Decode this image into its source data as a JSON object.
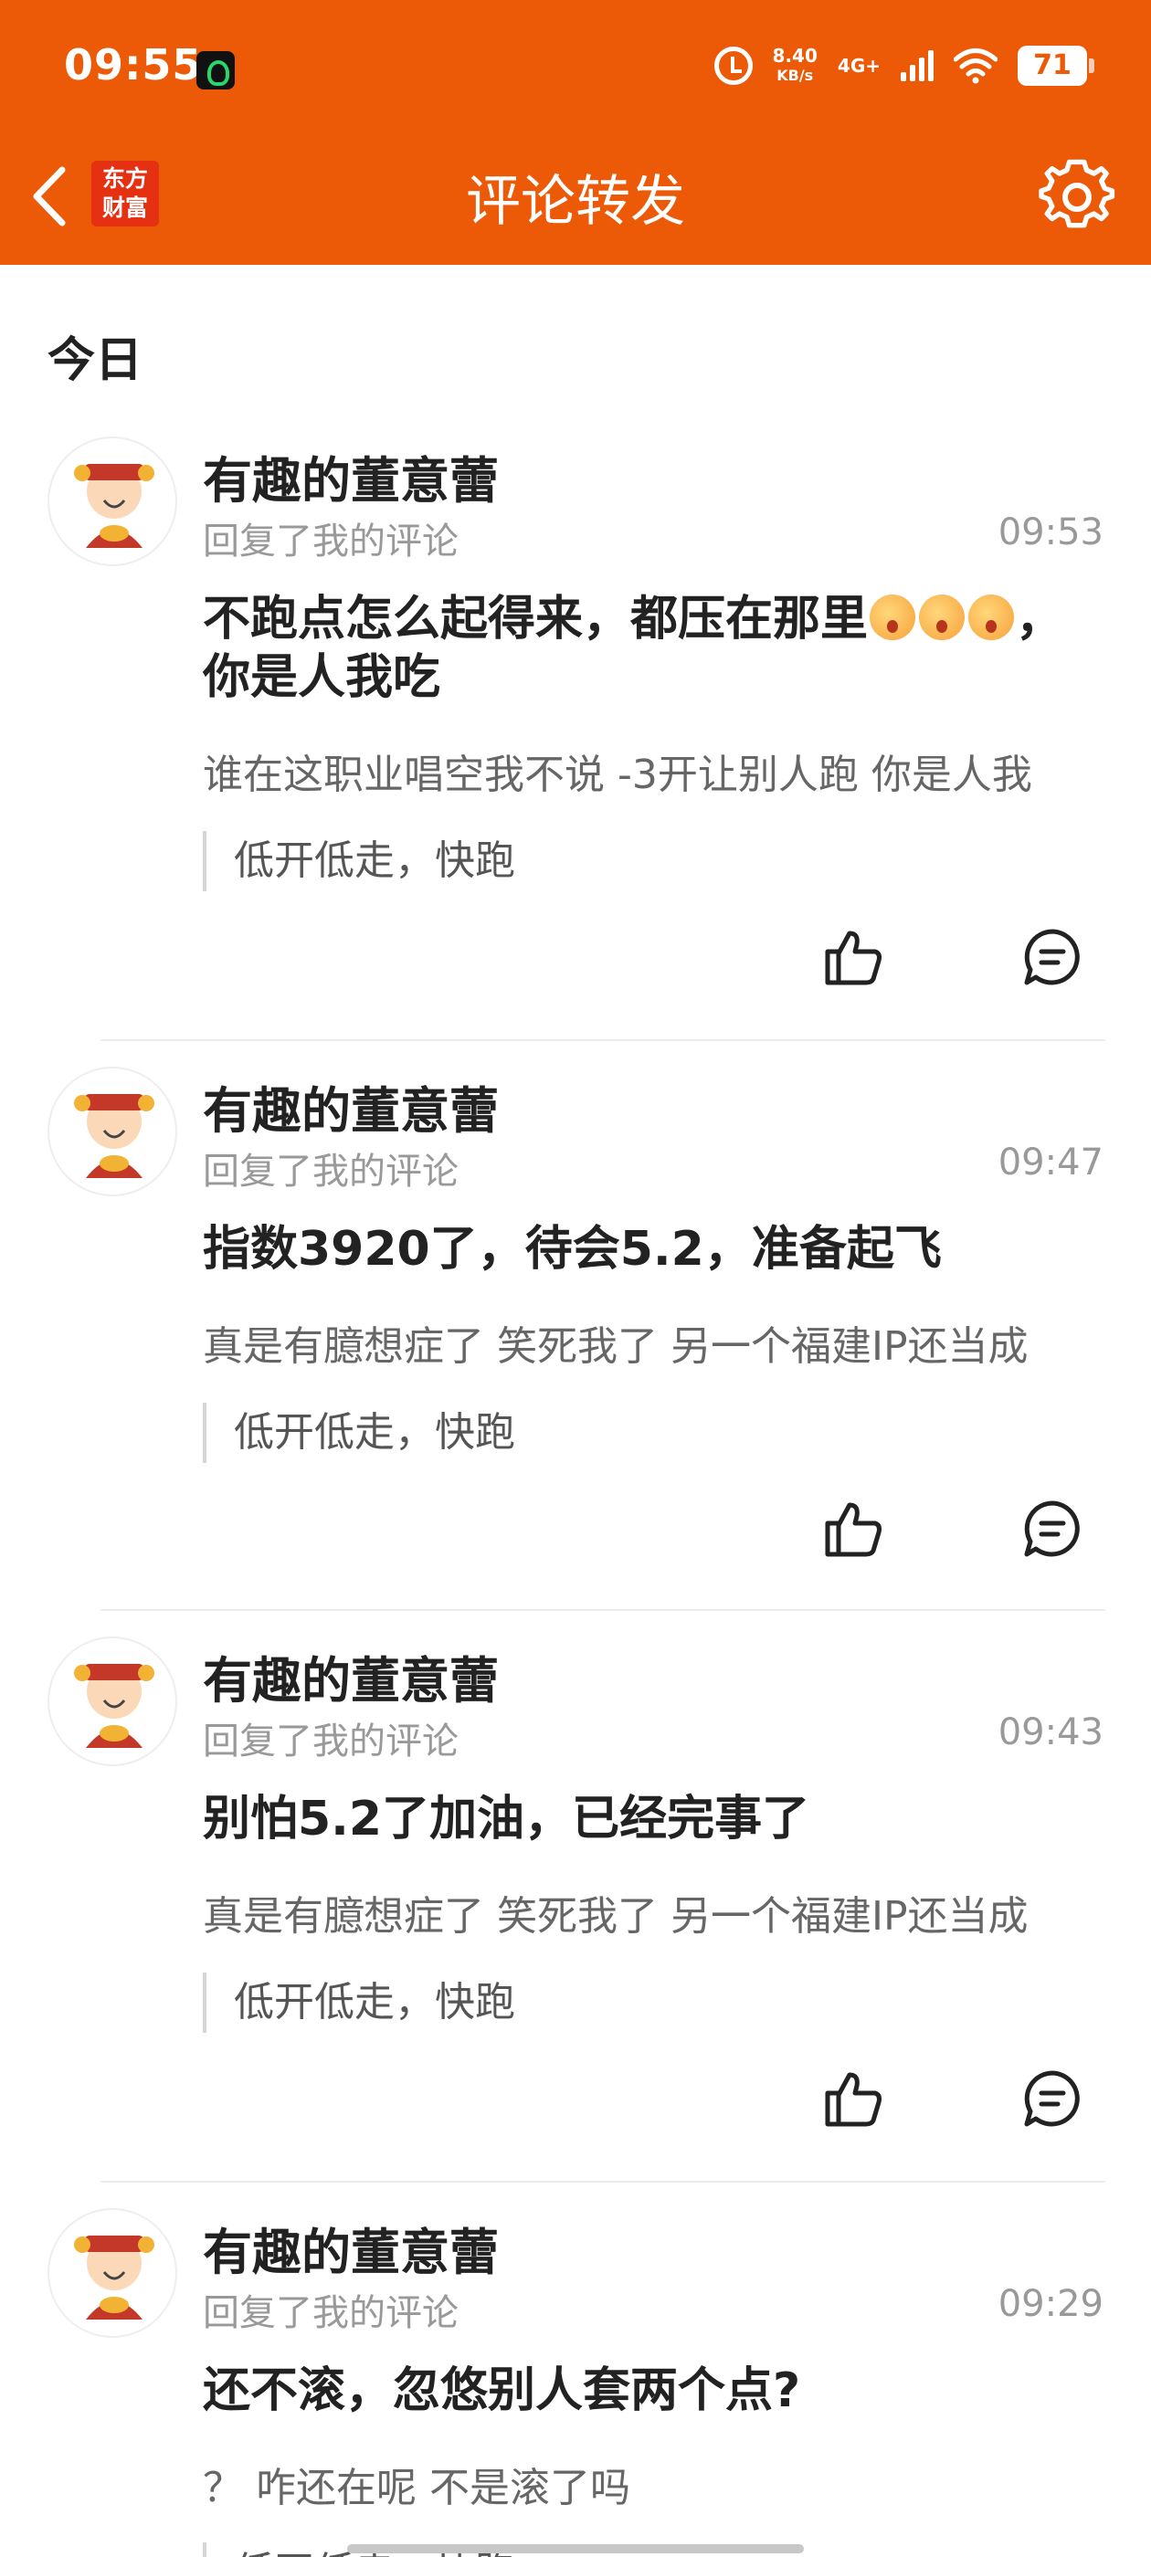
{
  "status_bar": {
    "time": "09:55",
    "speed_top": "8.40",
    "speed_bottom": "KB/s",
    "network": "4G+",
    "battery": "71"
  },
  "header": {
    "logo_line1": "东方",
    "logo_line2": "财富",
    "title": "评论转发"
  },
  "section": {
    "title": "今日"
  },
  "items": [
    {
      "username": "有趣的董意蕾",
      "action": "回复了我的评论",
      "time": "09:53",
      "content_line1": "不跑点怎么起得来，都压在那里",
      "content_after_emoji": "，",
      "content_line2": "你是人我吃",
      "quote": "谁在这职业唱空我不说 -3开让别人跑 你是人我",
      "original": "低开低走，快跑"
    },
    {
      "username": "有趣的董意蕾",
      "action": "回复了我的评论",
      "time": "09:47",
      "content_line1": "指数3920了，待会5.2，准备起飞",
      "quote": "真是有臆想症了 笑死我了 另一个福建IP还当成",
      "original": "低开低走，快跑"
    },
    {
      "username": "有趣的董意蕾",
      "action": "回复了我的评论",
      "time": "09:43",
      "content_line1": "别怕5.2了加油，已经完事了",
      "quote": "真是有臆想症了 笑死我了 另一个福建IP还当成",
      "original": "低开低走，快跑"
    },
    {
      "username": "有趣的董意蕾",
      "action": "回复了我的评论",
      "time": "09:29",
      "content_line1": "还不滚，忽悠别人套两个点?",
      "quote": "？ 咋还在呢 不是滚了吗",
      "original": "低开低走，快跑"
    }
  ]
}
